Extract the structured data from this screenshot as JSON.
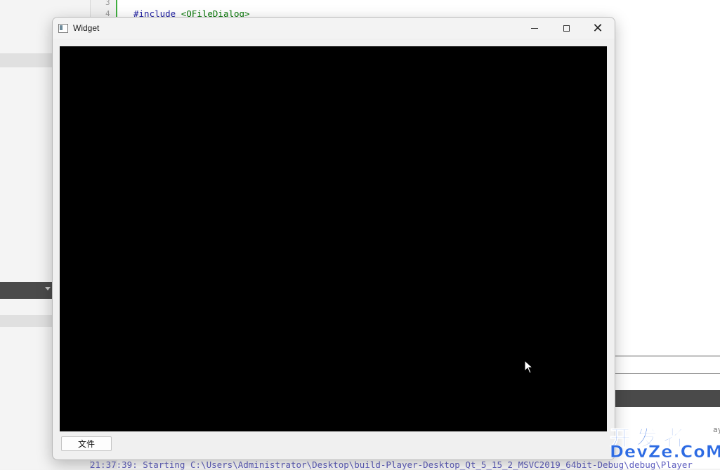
{
  "background_ide": {
    "line_numbers": [
      "3",
      "4"
    ],
    "code_line": {
      "keyword": "#include",
      "header": "<QFileDialog>"
    },
    "console_text": "21:37:39: Starting C:\\Users\\Administrator\\Desktop\\build-Player-Desktop_Qt_5_15_2_MSVC2019_64bit-Debug\\debug\\Player",
    "right_clip_text": "ay"
  },
  "window": {
    "title": "Widget",
    "controls": {
      "minimize": "minimize",
      "maximize": "maximize",
      "close": "close"
    },
    "file_button_label": "文件"
  },
  "watermark": {
    "line1": "开发者",
    "line2": "DevZe.CoM"
  },
  "colors": {
    "video_bg": "#000000",
    "watermark": "#2d6be3"
  }
}
